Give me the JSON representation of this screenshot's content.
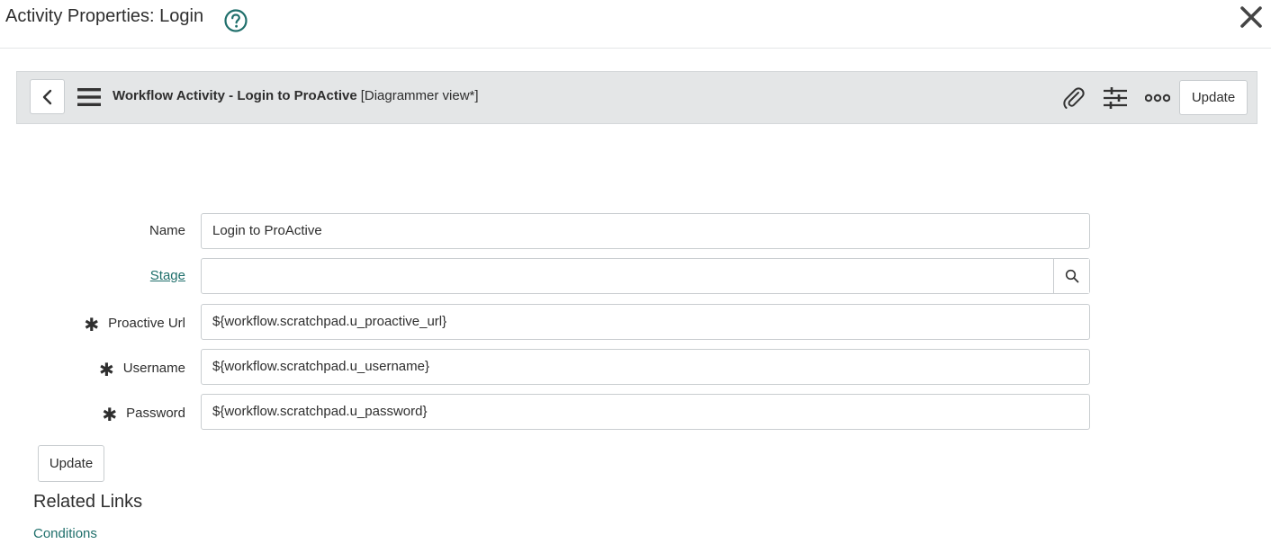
{
  "dialog": {
    "title": "Activity Properties: Login"
  },
  "form_header": {
    "record_title": "Workflow Activity - Login to ProActive",
    "view_label": "[Diagrammer view*]",
    "update_label": "Update"
  },
  "fields": {
    "name": {
      "label": "Name",
      "value": "Login to ProActive"
    },
    "stage": {
      "label": "Stage",
      "value": ""
    },
    "proactive_url": {
      "label": "Proactive Url",
      "mandatory_mark": "✱",
      "value": "${workflow.scratchpad.u_proactive_url}"
    },
    "username": {
      "label": "Username",
      "mandatory_mark": "✱",
      "value": "${workflow.scratchpad.u_username}"
    },
    "password": {
      "label": "Password",
      "mandatory_mark": "✱",
      "value": "${workflow.scratchpad.u_password}"
    }
  },
  "actions": {
    "update_label": "Update"
  },
  "related_links": {
    "title": "Related Links",
    "items": [
      {
        "label": "Conditions"
      }
    ]
  },
  "icons": {
    "help": "help-circle-icon",
    "close": "close-icon",
    "back": "chevron-left-icon",
    "menu": "hamburger-menu-icon",
    "attach": "paperclip-icon",
    "personalize": "sliders-icon",
    "more": "more-options-icon",
    "lookup": "search-icon"
  },
  "colors": {
    "accent": "#1f6f6b",
    "header_bg": "#e4e6e7",
    "border": "#c9cdd0"
  }
}
